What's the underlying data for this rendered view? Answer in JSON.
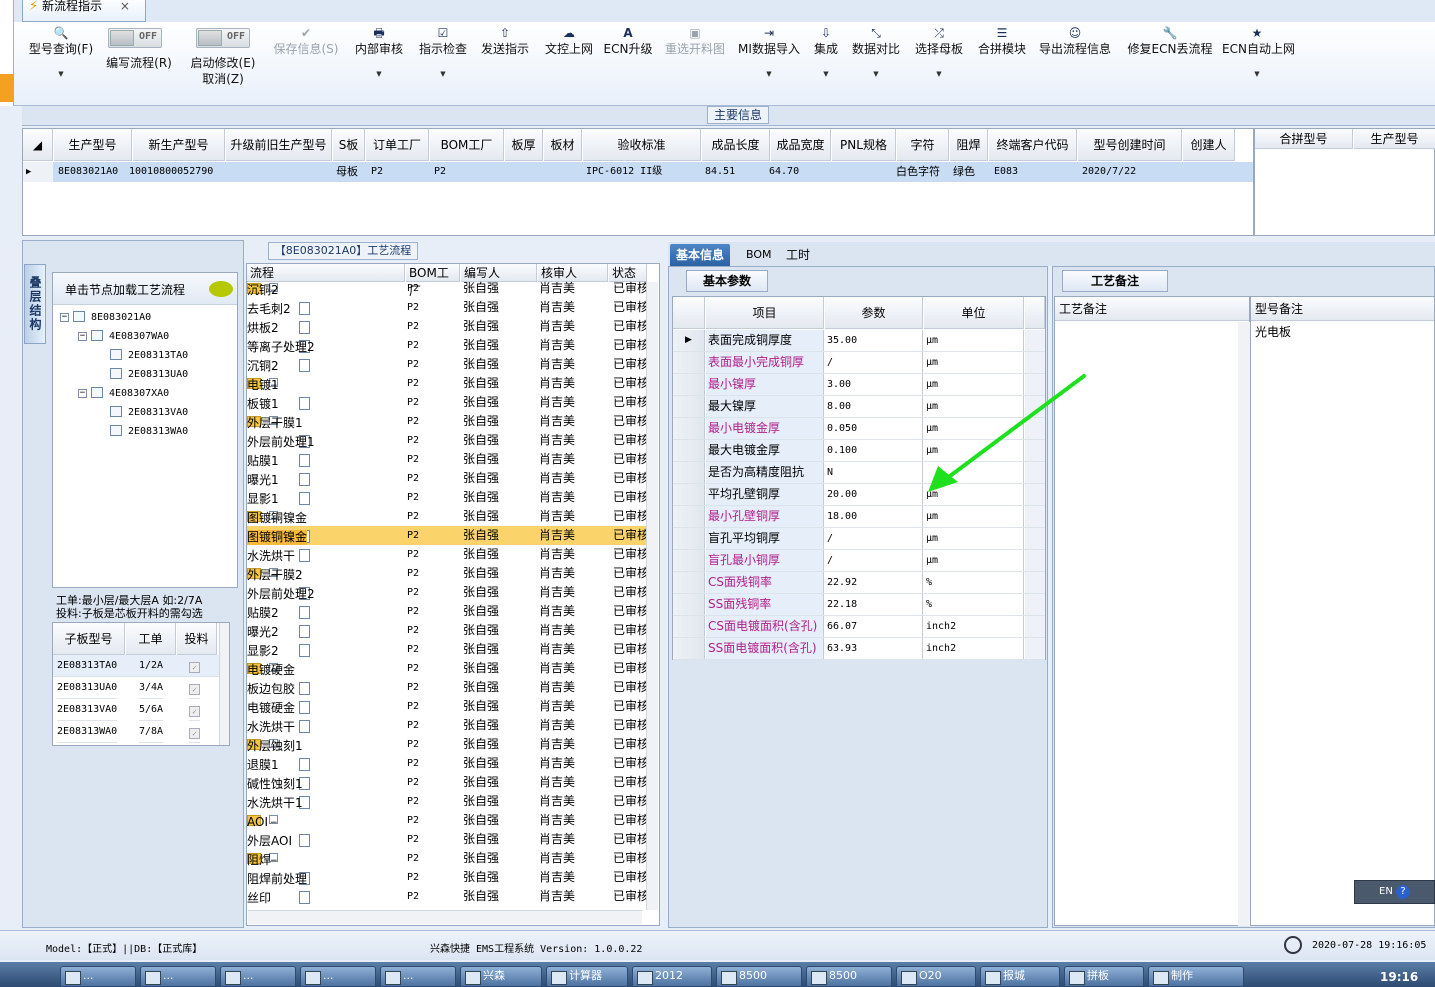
{
  "window": {
    "tab_title": "新流程指示",
    "close_glyph": "×"
  },
  "toolbar": {
    "items": [
      {
        "label": "型号查询(F)",
        "icon": "search-icon",
        "glyph": "🔍"
      },
      {
        "label": "编写流程(R)",
        "toggle": "OFF"
      },
      {
        "label": "启动修改(E)",
        "label2": "取消(Z)",
        "toggle": "OFF"
      },
      {
        "label": "保存信息(S)",
        "icon": "save-icon",
        "glyph": "✔",
        "disabled": true
      },
      {
        "label": "内部审核",
        "icon": "print-icon",
        "glyph": "🖶"
      },
      {
        "label": "指示检查",
        "icon": "check-icon",
        "glyph": "☑"
      },
      {
        "label": "发送指示",
        "icon": "upload-icon",
        "glyph": "⇧"
      },
      {
        "label": "文控上网",
        "icon": "cloud-icon",
        "glyph": "☁"
      },
      {
        "label": "ECN升级",
        "icon": "font-icon",
        "glyph": "A"
      },
      {
        "label": "重选开料图",
        "icon": "image-icon",
        "glyph": "▣",
        "disabled": true
      },
      {
        "label": "MI数据导入",
        "icon": "import-icon",
        "glyph": "⇥"
      },
      {
        "label": "集成",
        "icon": "download-icon",
        "glyph": "⇩"
      },
      {
        "label": "数据对比",
        "icon": "compare-icon",
        "glyph": "⤡"
      },
      {
        "label": "选择母板",
        "icon": "shuffle-icon",
        "glyph": "⤮"
      },
      {
        "label": "合拼模块",
        "icon": "list-icon",
        "glyph": "☰"
      },
      {
        "label": "导出流程信息",
        "icon": "smiley-icon",
        "glyph": "☺"
      },
      {
        "label": "修复ECN丢流程",
        "icon": "wrench-icon",
        "glyph": "🔧"
      },
      {
        "label": "ECN自动上网",
        "icon": "star-icon",
        "glyph": "★"
      }
    ]
  },
  "main_info": {
    "title": "主要信息",
    "columns": [
      "生产型号",
      "新生产型号",
      "升级前旧生产型号",
      "S板",
      "订单工厂",
      "BOM工厂",
      "板厚",
      "板材",
      "验收标准",
      "成品长度",
      "成品宽度",
      "PNL规格",
      "字符",
      "阻焊",
      "终端客户代码",
      "型号创建时间",
      "创建人"
    ],
    "row": [
      "8E083021A0",
      "10010800052790",
      "",
      "母板",
      "P2",
      "P2",
      "",
      "",
      "IPC-6012 II级",
      "84.51",
      "64.70",
      "",
      "白色字符",
      "绿色",
      "E083",
      "2020/7/22",
      ""
    ],
    "side_columns": [
      "合拼型号",
      "生产型号"
    ]
  },
  "left_panel": {
    "vertical_tab": "叠层结构",
    "tree_hint": "单击节点加载工艺流程",
    "tree": [
      {
        "label": "8E083021A0",
        "level": 0
      },
      {
        "label": "4E08307WA0",
        "level": 1
      },
      {
        "label": "2E08313TA0",
        "level": 2
      },
      {
        "label": "2E08313UA0",
        "level": 2
      },
      {
        "label": "4E08307XA0",
        "level": 1
      },
      {
        "label": "2E08313VA0",
        "level": 2
      },
      {
        "label": "2E08313WA0",
        "level": 2
      }
    ],
    "info_line1": "工单:最小层/最大层A 如:2/7A",
    "info_line2": "投料:子板是芯板开料的需勾选",
    "sub_columns": [
      "子板型号",
      "工单",
      "投料"
    ],
    "sub_rows": [
      [
        "2E08313TA0",
        "1/2A"
      ],
      [
        "2E08313UA0",
        "3/4A"
      ],
      [
        "2E08313VA0",
        "5/6A"
      ],
      [
        "2E08313WA0",
        "7/8A"
      ]
    ]
  },
  "process": {
    "title": "【8E083021A0】工艺流程",
    "columns": [
      "流程",
      "BOM工厂",
      "编写人",
      "核审人",
      "状态"
    ],
    "rows": [
      {
        "name": "沉铜2",
        "type": "folder",
        "factory": "P2",
        "writer": "张自强",
        "reviewer": "肖吉美",
        "status": "已审核"
      },
      {
        "name": "去毛刺2",
        "type": "doc",
        "factory": "P2",
        "writer": "张自强",
        "reviewer": "肖吉美",
        "status": "已审核"
      },
      {
        "name": "烘板2",
        "type": "doc",
        "factory": "P2",
        "writer": "张自强",
        "reviewer": "肖吉美",
        "status": "已审核"
      },
      {
        "name": "等离子处理2",
        "type": "doc",
        "factory": "P2",
        "writer": "张自强",
        "reviewer": "肖吉美",
        "status": "已审核"
      },
      {
        "name": "沉铜2",
        "type": "doc",
        "factory": "P2",
        "writer": "张自强",
        "reviewer": "肖吉美",
        "status": "已审核"
      },
      {
        "name": "电镀1",
        "type": "folder",
        "factory": "P2",
        "writer": "张自强",
        "reviewer": "肖吉美",
        "status": "已审核"
      },
      {
        "name": "板镀1",
        "type": "doc",
        "factory": "P2",
        "writer": "张自强",
        "reviewer": "肖吉美",
        "status": "已审核"
      },
      {
        "name": "外层干膜1",
        "type": "folder",
        "factory": "P2",
        "writer": "张自强",
        "reviewer": "肖吉美",
        "status": "已审核"
      },
      {
        "name": "外层前处理1",
        "type": "doc",
        "factory": "P2",
        "writer": "张自强",
        "reviewer": "肖吉美",
        "status": "已审核"
      },
      {
        "name": "贴膜1",
        "type": "doc",
        "factory": "P2",
        "writer": "张自强",
        "reviewer": "肖吉美",
        "status": "已审核"
      },
      {
        "name": "曝光1",
        "type": "doc",
        "factory": "P2",
        "writer": "张自强",
        "reviewer": "肖吉美",
        "status": "已审核"
      },
      {
        "name": "显影1",
        "type": "doc",
        "factory": "P2",
        "writer": "张自强",
        "reviewer": "肖吉美",
        "status": "已审核"
      },
      {
        "name": "图镀铜镍金",
        "type": "folder",
        "factory": "P2",
        "writer": "张自强",
        "reviewer": "肖吉美",
        "status": "已审核"
      },
      {
        "name": "图镀铜镍金",
        "type": "doc",
        "factory": "P2",
        "writer": "张自强",
        "reviewer": "肖吉美",
        "status": "已审核",
        "selected": true
      },
      {
        "name": "水洗烘干",
        "type": "doc",
        "factory": "P2",
        "writer": "张自强",
        "reviewer": "肖吉美",
        "status": "已审核"
      },
      {
        "name": "外层干膜2",
        "type": "folder",
        "factory": "P2",
        "writer": "张自强",
        "reviewer": "肖吉美",
        "status": "已审核"
      },
      {
        "name": "外层前处理2",
        "type": "doc",
        "factory": "P2",
        "writer": "张自强",
        "reviewer": "肖吉美",
        "status": "已审核"
      },
      {
        "name": "贴膜2",
        "type": "doc",
        "factory": "P2",
        "writer": "张自强",
        "reviewer": "肖吉美",
        "status": "已审核"
      },
      {
        "name": "曝光2",
        "type": "doc",
        "factory": "P2",
        "writer": "张自强",
        "reviewer": "肖吉美",
        "status": "已审核"
      },
      {
        "name": "显影2",
        "type": "doc",
        "factory": "P2",
        "writer": "张自强",
        "reviewer": "肖吉美",
        "status": "已审核"
      },
      {
        "name": "电镀硬金",
        "type": "folder",
        "factory": "P2",
        "writer": "张自强",
        "reviewer": "肖吉美",
        "status": "已审核"
      },
      {
        "name": "板边包胶",
        "type": "doc",
        "factory": "P2",
        "writer": "张自强",
        "reviewer": "肖吉美",
        "status": "已审核"
      },
      {
        "name": "电镀硬金",
        "type": "doc",
        "factory": "P2",
        "writer": "张自强",
        "reviewer": "肖吉美",
        "status": "已审核"
      },
      {
        "name": "水洗烘干",
        "type": "doc",
        "factory": "P2",
        "writer": "张自强",
        "reviewer": "肖吉美",
        "status": "已审核"
      },
      {
        "name": "外层蚀刻1",
        "type": "folder",
        "factory": "P2",
        "writer": "张自强",
        "reviewer": "肖吉美",
        "status": "已审核"
      },
      {
        "name": "退膜1",
        "type": "doc",
        "factory": "P2",
        "writer": "张自强",
        "reviewer": "肖吉美",
        "status": "已审核"
      },
      {
        "name": "碱性蚀刻1",
        "type": "doc",
        "factory": "P2",
        "writer": "张自强",
        "reviewer": "肖吉美",
        "status": "已审核"
      },
      {
        "name": "水洗烘干1",
        "type": "doc",
        "factory": "P2",
        "writer": "张自强",
        "reviewer": "肖吉美",
        "status": "已审核"
      },
      {
        "name": "AOI",
        "type": "folder",
        "factory": "P2",
        "writer": "张自强",
        "reviewer": "肖吉美",
        "status": "已审核"
      },
      {
        "name": "外层AOI",
        "type": "doc",
        "factory": "P2",
        "writer": "张自强",
        "reviewer": "肖吉美",
        "status": "已审核"
      },
      {
        "name": "阻焊",
        "type": "folder",
        "factory": "P2",
        "writer": "张自强",
        "reviewer": "肖吉美",
        "status": "已审核"
      },
      {
        "name": "阻焊前处理",
        "type": "doc",
        "factory": "P2",
        "writer": "张自强",
        "reviewer": "肖吉美",
        "status": "已审核"
      },
      {
        "name": "丝印",
        "type": "doc",
        "factory": "P2",
        "writer": "张自强",
        "reviewer": "肖吉美",
        "status": "已审核"
      }
    ]
  },
  "detail": {
    "tabs": [
      "基本信息",
      "BOM",
      "工时"
    ],
    "section_tab": "基本参数",
    "columns": [
      "项目",
      "参数",
      "单位"
    ],
    "rows": [
      {
        "item": "表面完成铜厚度",
        "value": "35.00",
        "unit": "μm",
        "pink": false,
        "current": true
      },
      {
        "item": "表面最小完成铜厚",
        "value": "/",
        "unit": "μm",
        "pink": true
      },
      {
        "item": "最小镍厚",
        "value": "3.00",
        "unit": "μm",
        "pink": true
      },
      {
        "item": "最大镍厚",
        "value": "8.00",
        "unit": "μm",
        "pink": false
      },
      {
        "item": "最小电镀金厚",
        "value": "0.050",
        "unit": "μm",
        "pink": true
      },
      {
        "item": "最大电镀金厚",
        "value": "0.100",
        "unit": "μm",
        "pink": false
      },
      {
        "item": "是否为高精度阻抗",
        "value": "N",
        "unit": "",
        "pink": false
      },
      {
        "item": "平均孔壁铜厚",
        "value": "20.00",
        "unit": "μm",
        "pink": false
      },
      {
        "item": "最小孔壁铜厚",
        "value": "18.00",
        "unit": "μm",
        "pink": true
      },
      {
        "item": "盲孔平均铜厚",
        "value": "/",
        "unit": "μm",
        "pink": false
      },
      {
        "item": "盲孔最小铜厚",
        "value": "/",
        "unit": "μm",
        "pink": true
      },
      {
        "item": "CS面残铜率",
        "value": "22.92",
        "unit": "%",
        "pink": true
      },
      {
        "item": "SS面残铜率",
        "value": "22.18",
        "unit": "%",
        "pink": true
      },
      {
        "item": "CS面电镀面积(含孔)",
        "value": "66.07",
        "unit": "inch2",
        "pink": true
      },
      {
        "item": "SS面电镀面积(含孔)",
        "value": "63.93",
        "unit": "inch2",
        "pink": true
      }
    ]
  },
  "notes": {
    "tab": "工艺备注",
    "left_header": "工艺备注",
    "right_header": "型号备注",
    "right_value": "光电板"
  },
  "status_bar": {
    "left": "Model:【正式】||DB:【正式库】",
    "center": "兴森快捷 EMS工程系统 Version: 1.0.0.22",
    "datetime": "2020-07-28 19:16:05"
  },
  "taskbar": {
    "clock": "19:16",
    "lang": "EN",
    "items": [
      "...",
      "...",
      "...",
      "...",
      "...",
      "兴森",
      "计算器",
      "2012",
      "8500",
      "8500",
      "O20",
      "报城",
      "拼板",
      "制作"
    ]
  },
  "annotation": {
    "color": "#1fe01f"
  }
}
